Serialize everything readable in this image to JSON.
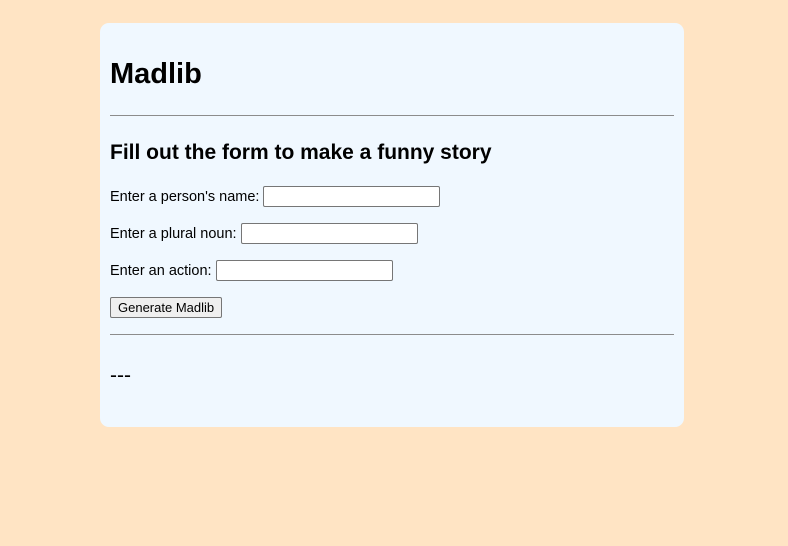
{
  "page": {
    "title": "Madlib",
    "subtitle": "Fill out the form to make a funny story"
  },
  "form": {
    "name_label": "Enter a person's name:",
    "name_value": "",
    "noun_label": "Enter a plural noun:",
    "noun_value": "",
    "action_label": "Enter an action:",
    "action_value": "",
    "submit_label": "Generate Madlib"
  },
  "result": {
    "text": "---"
  },
  "colors": {
    "background": "#ffe4c4",
    "card": "#f0f8ff"
  }
}
